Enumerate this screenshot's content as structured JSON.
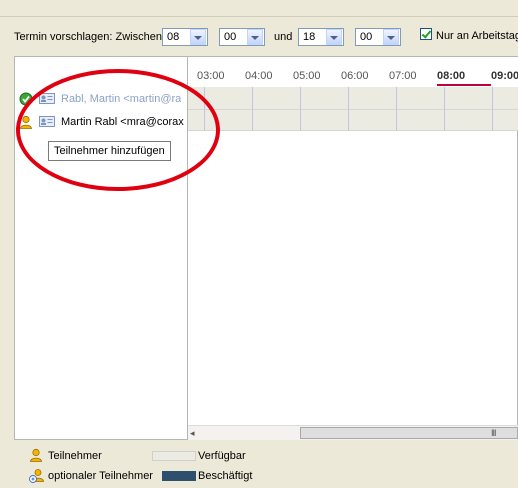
{
  "toolbar": {
    "suggest_label": "Termin vorschlagen: Zwischen",
    "from_hour": "08",
    "from_minute": "00",
    "and_label": "und",
    "to_hour": "18",
    "to_minute": "00",
    "workdays_label": "Nur an Arbeitstag",
    "workdays_checked": true
  },
  "timeline": {
    "hours": [
      "03:00",
      "04:00",
      "05:00",
      "06:00",
      "07:00",
      "08:00",
      "09:00"
    ],
    "current_hour": "08:00"
  },
  "participants": [
    {
      "name": "Rabl, Martin <martin@ra",
      "status_icon": "check-status-icon",
      "grayed": true
    },
    {
      "name": "Martin Rabl <mra@corax",
      "status_icon": "person-icon",
      "grayed": false
    }
  ],
  "add_participant_label": "Teilnehmer hinzufügen",
  "scrollbar": {
    "grip": "III"
  },
  "legend": {
    "participant": "Teilnehmer",
    "optional_participant": "optionaler Teilnehmer",
    "available": "Verfügbar",
    "busy": "Beschäftigt"
  },
  "colors": {
    "available": "#ecebe2",
    "busy": "#2f4f6f",
    "highlight_oval": "#e00010",
    "now_marker": "#c0003a"
  }
}
